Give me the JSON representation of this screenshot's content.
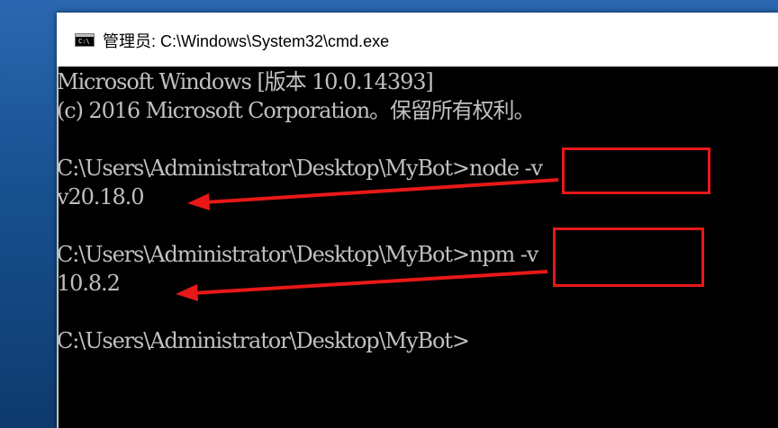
{
  "window": {
    "title": "管理员: C:\\Windows\\System32\\cmd.exe",
    "icon_text": "C:\\"
  },
  "console": {
    "lines": [
      "Microsoft Windows [版本 10.0.14393]",
      "(c) 2016 Microsoft Corporation。保留所有权利。",
      "",
      "C:\\Users\\Administrator\\Desktop\\MyBot>node -v",
      "v20.18.0",
      "",
      "C:\\Users\\Administrator\\Desktop\\MyBot>npm -v",
      "10.8.2",
      "",
      "C:\\Users\\Administrator\\Desktop\\MyBot>"
    ]
  },
  "annotations": {
    "highlight_color": "#e81818",
    "highlighted_commands": [
      "node -v",
      "npm -v"
    ],
    "arrow_targets": [
      "v20.18.0",
      "10.8.2"
    ]
  },
  "colors": {
    "console_bg": "#000000",
    "console_text": "#c0c0c0",
    "titlebar_bg": "#ffffff"
  }
}
